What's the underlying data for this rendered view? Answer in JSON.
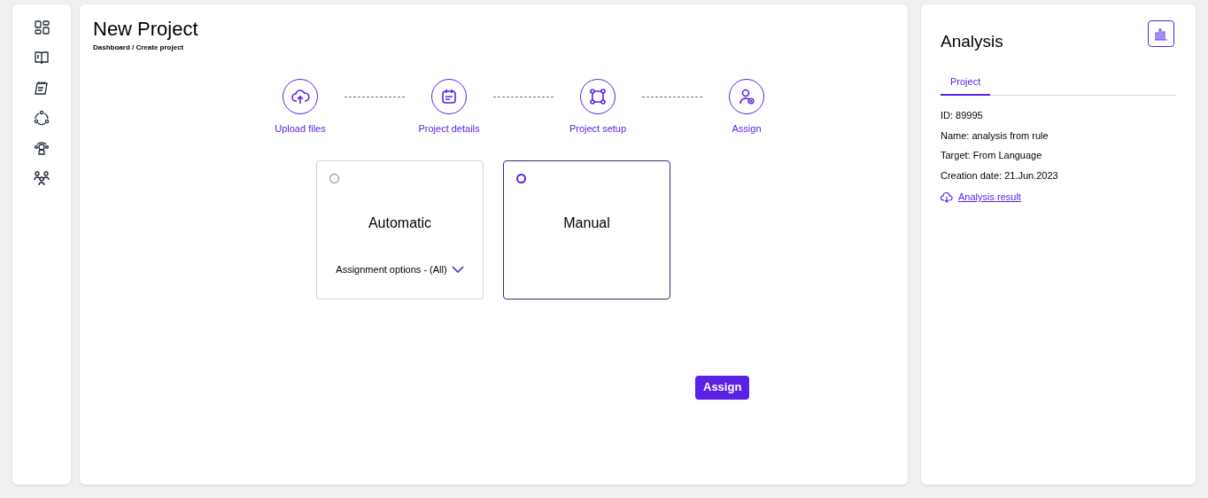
{
  "header": {
    "title": "New Project",
    "breadcrumb": "Dashboard / Create project"
  },
  "steps": [
    {
      "label": "Upload files"
    },
    {
      "label": "Project details"
    },
    {
      "label": "Project setup"
    },
    {
      "label": "Assign"
    }
  ],
  "options": [
    {
      "title": "Automatic",
      "selected": false,
      "dropdown": "Assignment options - (All)"
    },
    {
      "title": "Manual",
      "selected": true
    }
  ],
  "assign_button": "Assign",
  "analysis": {
    "title": "Analysis",
    "tabs": [
      {
        "label": "Project",
        "selected": true
      }
    ],
    "fields": [
      "ID: 89995",
      "Name: analysis from rule",
      "Target: From Language",
      "Creation date: 21.Jun.2023"
    ],
    "link": "Analysis result"
  }
}
